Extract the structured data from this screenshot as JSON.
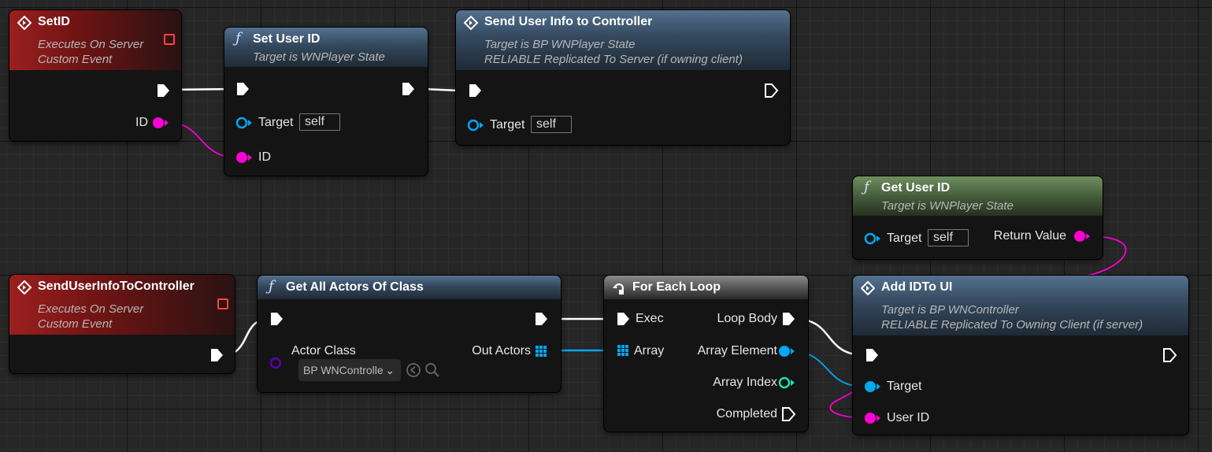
{
  "nodes": {
    "setid_event": {
      "title": "SetID",
      "sub1": "Executes On Server",
      "sub2": "Custom Event",
      "pin_id": "ID"
    },
    "set_user_id": {
      "title": "Set User ID",
      "sub1": "Target is WNPlayer State",
      "pin_target": "Target",
      "target_value": "self",
      "pin_id": "ID"
    },
    "send_user_info": {
      "title": "Send User Info to Controller",
      "sub1": "Target is BP WNPlayer State",
      "sub2": "RELIABLE Replicated To Server (if owning client)",
      "pin_target": "Target",
      "target_value": "self"
    },
    "get_user_id": {
      "title": "Get User ID",
      "sub1": "Target is WNPlayer State",
      "pin_target": "Target",
      "target_value": "self",
      "pin_return": "Return Value"
    },
    "senduserinfo_event": {
      "title": "SendUserInfoToController",
      "sub1": "Executes On Server",
      "sub2": "Custom Event"
    },
    "get_all_actors": {
      "title": "Get All Actors Of Class",
      "pin_actor_class": "Actor Class",
      "actor_class_value": "BP WNControlle",
      "pin_out_actors": "Out Actors"
    },
    "for_each_loop": {
      "title": "For Each Loop",
      "pin_exec": "Exec",
      "pin_array": "Array",
      "pin_loop_body": "Loop Body",
      "pin_array_element": "Array Element",
      "pin_array_index": "Array Index",
      "pin_completed": "Completed"
    },
    "add_id_to_ui": {
      "title": "Add IDTo UI",
      "sub1": "Target is BP WNController",
      "sub2": "RELIABLE Replicated To Owning Client (if server)",
      "pin_target": "Target",
      "pin_user_id": "User ID"
    }
  },
  "colors": {
    "exec": "#ffffff",
    "string_pin": "#ff00d4",
    "object_pin": "#00a8f3",
    "class_pin": "#5b00a8",
    "int_pin": "#1fe0b0",
    "event_header": "#9b1f1f",
    "function_header": "#53718f",
    "pure_header": "#6f8f5e",
    "macro_header": "#8a8a8a"
  }
}
